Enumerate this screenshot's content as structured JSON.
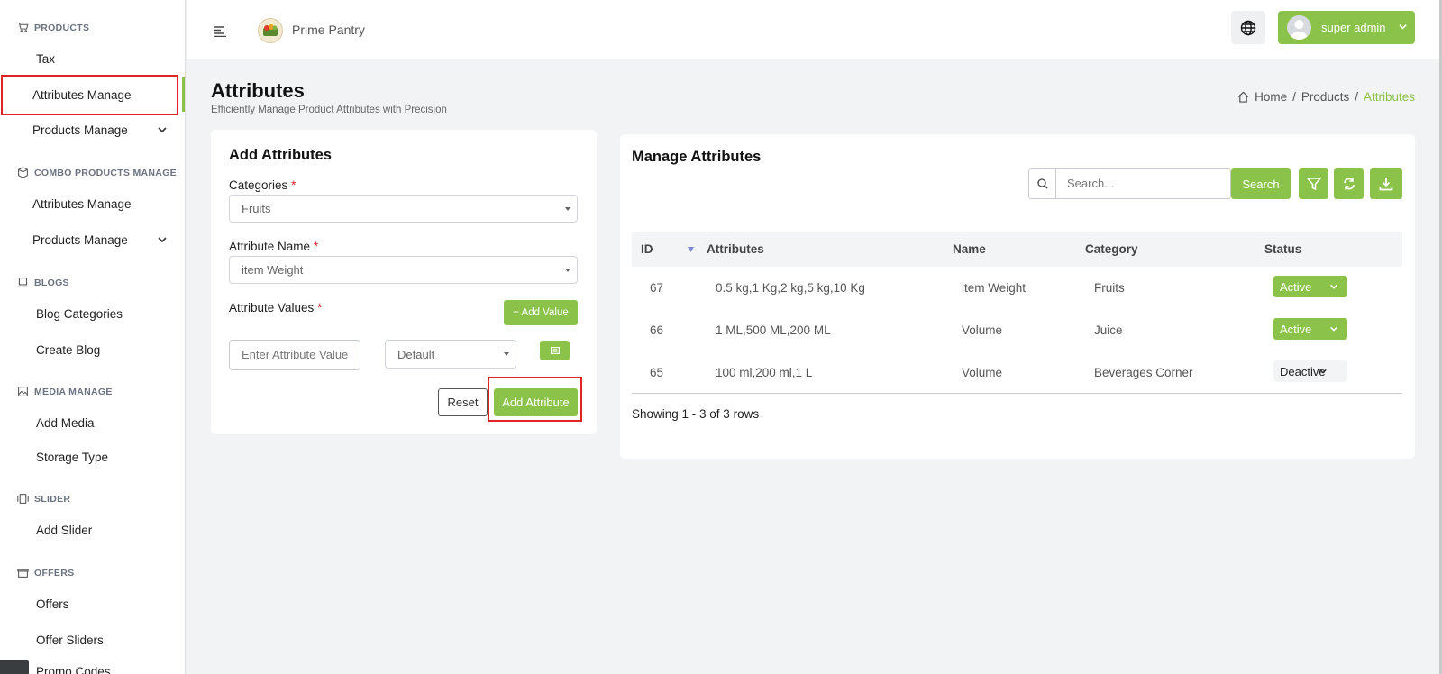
{
  "brand": {
    "name": "Prime Pantry"
  },
  "user": {
    "name": "super admin"
  },
  "sidebar": {
    "sections": [
      {
        "title": "PRODUCTS",
        "icon": "cart-icon"
      },
      {
        "title": "COMBO PRODUCTS MANAGE",
        "icon": "box-icon"
      },
      {
        "title": "BLOGS",
        "icon": "laptop-icon"
      },
      {
        "title": "MEDIA MANAGE",
        "icon": "image-icon"
      },
      {
        "title": "SLIDER",
        "icon": "slider-icon"
      },
      {
        "title": "OFFERS",
        "icon": "gift-icon"
      }
    ],
    "items": {
      "tax": "Tax",
      "attributes_manage": "Attributes Manage",
      "products_manage": "Products Manage",
      "combo_attributes_manage": "Attributes Manage",
      "combo_products_manage": "Products Manage",
      "blog_categories": "Blog Categories",
      "create_blog": "Create Blog",
      "add_media": "Add Media",
      "storage_type": "Storage Type",
      "add_slider": "Add Slider",
      "offers": "Offers",
      "offer_sliders": "Offer Sliders",
      "promo_codes": "Promo Codes"
    }
  },
  "page": {
    "title": "Attributes",
    "subtitle": "Efficiently Manage Product Attributes with Precision",
    "breadcrumb": [
      "Home",
      "Products",
      "Attributes"
    ],
    "breadcrumb_sep": "/"
  },
  "form": {
    "title": "Add Attributes",
    "categories_label": "Categories",
    "categories_value": "Fruits",
    "attribute_name_label": "Attribute Name",
    "attribute_name_value": "item Weight",
    "attribute_values_label": "Attribute Values",
    "required_mark": "*",
    "add_value_button": "+ Add Value",
    "value_placeholder": "Enter Attribute Value",
    "type_value": "Default",
    "reset_button": "Reset",
    "submit_button": "Add Attribute"
  },
  "table": {
    "title": "Manage Attributes",
    "search_placeholder": "Search...",
    "search_button": "Search",
    "columns": [
      "ID",
      "Attributes",
      "Name",
      "Category",
      "Status"
    ],
    "rows": [
      {
        "id": "67",
        "attributes": "0.5 kg,1 Kg,2 kg,5 kg,10 Kg",
        "name": "item Weight",
        "category": "Fruits",
        "status": "Active"
      },
      {
        "id": "66",
        "attributes": "1 ML,500 ML,200 ML",
        "name": "Volume",
        "category": "Juice",
        "status": "Active"
      },
      {
        "id": "65",
        "attributes": "100 ml,200 ml,1 L",
        "name": "Volume",
        "category": "Beverages Corner",
        "status": "Deactive"
      }
    ],
    "footer": "Showing 1 - 3 of 3 rows"
  },
  "colors": {
    "accent": "#8bc34a",
    "highlight": "#e02424"
  }
}
